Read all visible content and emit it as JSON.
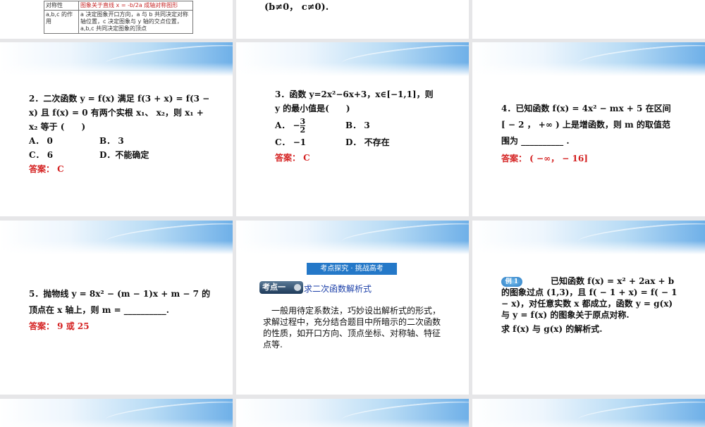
{
  "slide_top_left": {
    "table": [
      {
        "label": "对称性",
        "value": "图象关于直线 x = -b/2a 成轴对称图形"
      },
      {
        "label": "a,b,c 的作用",
        "value": "a 决定图象开口方向，a 与 b 共同决定对称轴位置，c 决定图象与 y 轴的交点位置，a,b,c 共同决定图象的顶点"
      }
    ]
  },
  "slide_top_mid": {
    "text": "(b≠0， c≠0)."
  },
  "q2": {
    "line1": "2．二次函数 y = f(x) 满足 f(3 + x) = f(3 −",
    "line2": "x) 且 f(x) = 0 有两个实根 x₁、 x₂，则 x₁ +",
    "line3": "x₂ 等于 (　　)",
    "a": "A． 0",
    "b": "B． 3",
    "c": "C． 6",
    "d": "D．不能确定",
    "answer": "答案： C"
  },
  "q3": {
    "line1": "3．函数 y=2x²−6x+3，x∈[−1,1]，则",
    "line2": "y 的最小值是(　　)",
    "a_prefix": "A． −",
    "a_num": "3",
    "a_den": "2",
    "b": "B． 3",
    "c": "C． −1",
    "d": "D． 不存在",
    "answer": "答案： C"
  },
  "q4": {
    "line1": "4．已知函数 f(x) = 4x² − mx + 5 在区间",
    "line2": "[ − 2 ， +∞ ) 上是增函数，则 m 的取值范",
    "line3": "围为 __________ .",
    "answer": "答案： ( −∞， − 16]"
  },
  "q5": {
    "line1": "5．抛物线 y = 8x² − (m − 1)x + m − 7 的",
    "line2": "顶点在 x 轴上，则 m = __________.",
    "answer": "答案： 9 或 25"
  },
  "s6": {
    "header": "考点探究 · 挑战高考",
    "badge": "考点一",
    "topic": "求二次函数解析式",
    "body": "一般用待定系数法，巧妙设出解析式的形式，求解过程中，充分结合题目中所暗示的二次函数的性质，如开口方向、顶点坐标、对称轴、特征点等."
  },
  "s7": {
    "badge": "例 1",
    "line1": "已知函数 f(x) = x² + 2ax + b",
    "line2": "的图象过点 (1,3)，且 f( − 1 + x) = f( − 1",
    "line3": "− x)，对任意实数 x 都成立，函数 y = g(x)",
    "line4": "与 y = f(x) 的图象关于原点对称.",
    "line5": "求 f(x) 与 g(x) 的解析式."
  }
}
